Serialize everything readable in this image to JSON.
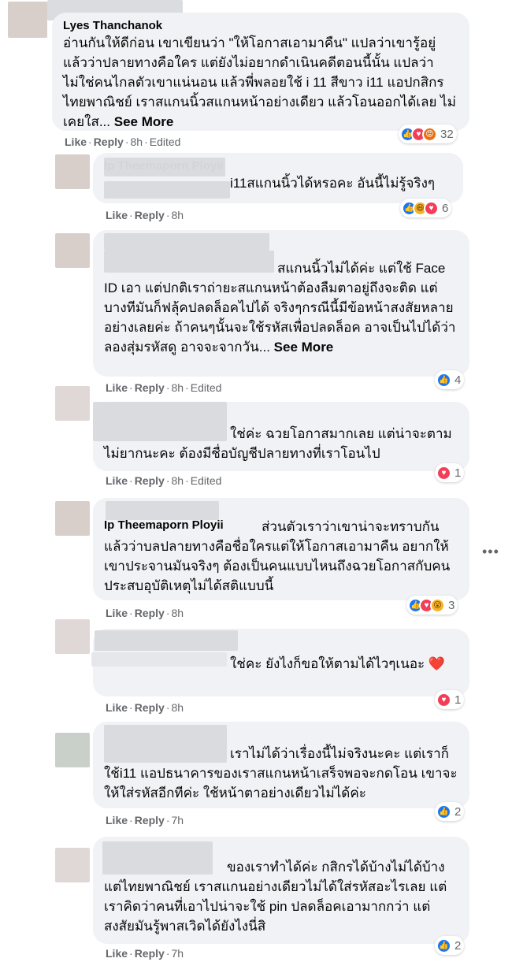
{
  "actions": {
    "like": "Like",
    "reply": "Reply",
    "edited": "Edited",
    "sep": "·"
  },
  "more_icon": "more-horizontal-icon",
  "comments": [
    {
      "name": "Lyes Thanchanok",
      "text": "อ่านกันให้ดีก่อน เขาเขียนว่า \"ให้โอกาสเอามาคืน\" แปลว่าเขารู้อยู่แล้วว่าปลายทางคือใคร แต่ยังไม่อยากดำเนินคดีตอนนี้นั้น แปลว่าไม่ใช่คนไกลตัวเขาแน่นอน แล้วพี่พลอยใช้ i 11 สีขาว i11 แอปกสิกร ไทยพาณิชย์ เราสแกนนิ้วสแกนหน้าอย่างเดียว แล้วโอนออกได้เลย ไม่เคยใส...",
      "more": "See More",
      "time": "8h",
      "edited": true,
      "reactions": [
        "like",
        "love",
        "angry"
      ],
      "count": "32"
    },
    {
      "name": "Ip Theemaporn Ployii",
      "text": "i11สแกนนิ้วได้หรอคะ อันนี้ไม่รู้จริงๆ",
      "time": "8h",
      "edited": false,
      "reactions": [
        "like",
        "haha",
        "love"
      ],
      "count": "6"
    },
    {
      "name": "",
      "text": "สแกนนิ้วไม่ได้ค่ะ แต่ใช้ Face ID เอา แต่ปกติเราถ่ายะสแกนหน้าต้องลืมตาอยู่ถึงจะติด แต่บางทีมันก็ฟลุ้คปลดล็อคไปได้ จริงๆกรณีนี้มีข้อหน้าสงสัยหลายอย่างเลยค่ะ ถ้าคนๆนั้นจะใช้รหัสเพื่อปลดล็อค อาจเป็นไปได้ว่า ลองสุ่มรหัสดู อาจจะจากวัน...",
      "more": "See More",
      "time": "8h",
      "edited": true,
      "reactions": [
        "like"
      ],
      "count": "4"
    },
    {
      "name": "",
      "text": "ใช่ค่ะ ฉวยโอกาสมากเลย แต่น่าจะตามไม่ยากนะคะ ต้องมีชื่อบัญชีปลายทางที่เราโอนไป",
      "time": "8h",
      "edited": true,
      "reactions": [
        "love"
      ],
      "count": "1"
    },
    {
      "name": "Ip Theemaporn Ployii",
      "text": "ส่วนตัวเราว่าเขาน่าจะทราบกันแล้วว่าบลปลายทางคือชื่อใครแต่ให้โอกาสเอามาคืน อยากให้เขาประจานมันจริงๆ ต้องเป็นคนแบบไหนถึงฉวยโอกาสกับคนประสบอุบัติเหตุไม่ได้สติแบบนี้",
      "time": "8h",
      "edited": false,
      "reactions": [
        "like",
        "love",
        "wow"
      ],
      "count": "3"
    },
    {
      "name": "",
      "text": "ใช่คะ ยังไงก็ขอให้ตามได้ไวๆเนอะ ❤️",
      "time": "8h",
      "edited": false,
      "reactions": [
        "love"
      ],
      "count": "1"
    },
    {
      "name": "",
      "text": "เราไม่ได้ว่าเรื่องนี้ไม่จริงนะคะ แต่เราก็ใช้i11 แอปธนาคารของเราสแกนหน้าเสร็จพอจะกดโอน เขาจะให้ใส่รหัสอีกทีค่ะ ใช้หน้าตาอย่างเดียวไม่ได้ค่ะ",
      "time": "7h",
      "edited": false,
      "reactions": [
        "like"
      ],
      "count": "2"
    },
    {
      "name": "",
      "text": "ของเราทำได้ค่ะ กสิกรได้บ้างไม่ได้บ้าง แต่ไทยพาณิชย์ เราสแกนอย่างเดียวไม่ได้ใส่รหัสอะไรเลย แต่เราคิดว่าคนที่เอาไปน่าจะใช้ pin ปลดล็อคเอามากกว่า แต่สงสัยมันรู้พาสเวิดได้ยังไงนี่สิ",
      "time": "7h",
      "edited": false,
      "reactions": [
        "like"
      ],
      "count": "2"
    }
  ]
}
